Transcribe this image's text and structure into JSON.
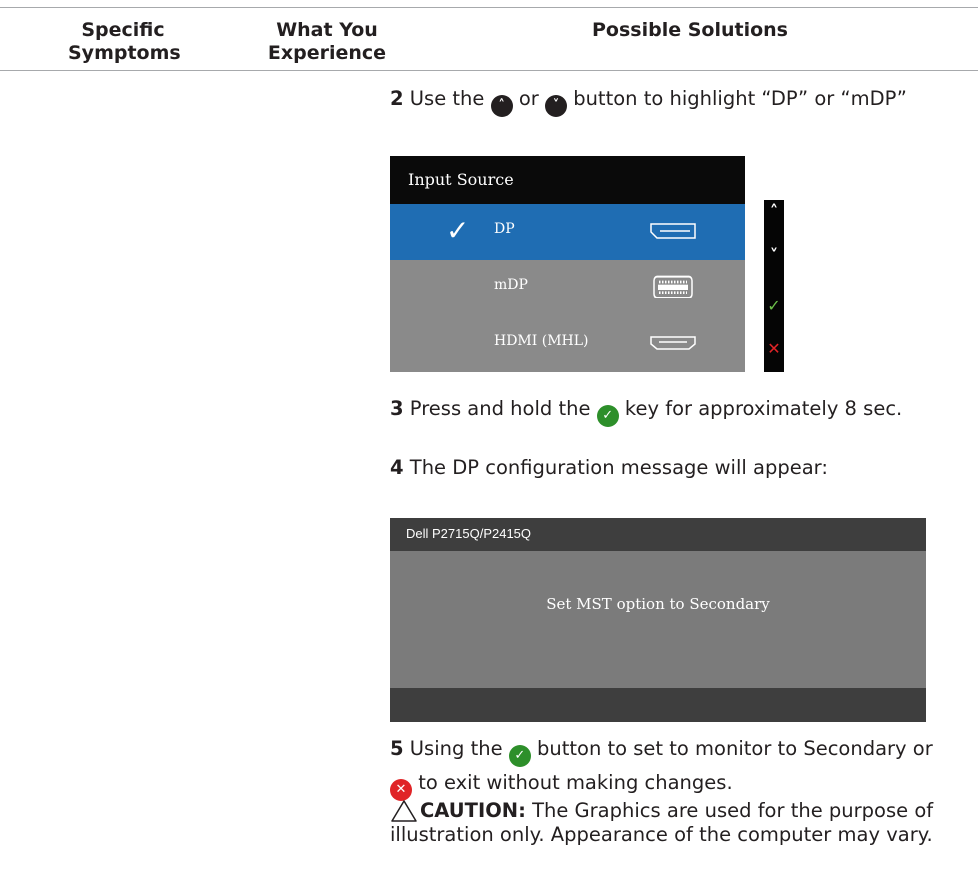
{
  "table": {
    "headers": {
      "symptoms": "Specific Symptoms",
      "experience": "What You Experience",
      "solutions": "Possible Solutions"
    }
  },
  "steps": {
    "step2": {
      "num": "2",
      "before": "Use the",
      "mid": "or",
      "after": "button to highlight “DP” or “mDP”"
    },
    "step3": {
      "num": "3",
      "before": "Press and hold the",
      "after": "key for approximately 8 sec."
    },
    "step4": {
      "num": "4",
      "text": "The DP configuration message will appear:"
    },
    "step5": {
      "num": "5",
      "before": "Using the",
      "mid": "button to set to monitor to Secondary or",
      "after": "to exit without making changes."
    }
  },
  "input_source_osd": {
    "title": "Input Source",
    "items": [
      {
        "label": "DP",
        "selected": true,
        "port_icon": "displayport-icon"
      },
      {
        "label": "mDP",
        "selected": false,
        "port_icon": "mini-displayport-icon"
      },
      {
        "label": "HDMI (MHL)",
        "selected": false,
        "port_icon": "hdmi-icon"
      }
    ],
    "side_buttons": [
      "up-icon",
      "down-icon",
      "check-icon",
      "close-icon"
    ]
  },
  "dp_message": {
    "title": "Dell P2715Q/P2415Q",
    "body": "Set MST option to Secondary"
  },
  "caution": {
    "label": "CAUTION:",
    "text": "The Graphics are used for the purpose of illustration only. Appearance of the computer may vary."
  },
  "colors": {
    "selected_row": "#1f6db3",
    "unselected_row": "#8a8a8a",
    "check_green": "#2d8f2a",
    "close_red": "#e02427"
  }
}
